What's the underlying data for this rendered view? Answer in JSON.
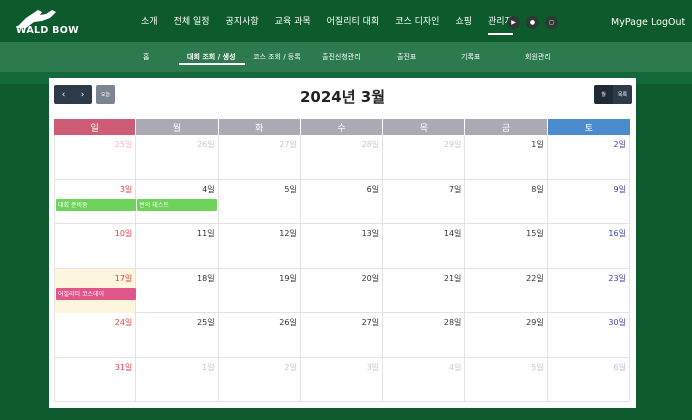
{
  "brand": {
    "name": "WALD BOW"
  },
  "nav": {
    "items": [
      {
        "label": "소개",
        "active": false
      },
      {
        "label": "전체 일정",
        "active": false
      },
      {
        "label": "공지사항",
        "active": false
      },
      {
        "label": "교육 과목",
        "active": false
      },
      {
        "label": "어질리티 대회",
        "active": false
      },
      {
        "label": "코스 디자인",
        "active": false
      },
      {
        "label": "쇼핑",
        "active": false
      },
      {
        "label": "관리자",
        "active": true
      }
    ],
    "social": [
      "youtube-icon",
      "kakao-icon",
      "instagram-icon"
    ],
    "util": {
      "mypage": "MyPage",
      "logout": "LogOut"
    }
  },
  "subnav": {
    "items": [
      {
        "label": "홈"
      },
      {
        "label": "대회 조회 / 생성"
      },
      {
        "label": "코스 조회 / 등록"
      },
      {
        "label": "출진신청관리"
      },
      {
        "label": "출진표"
      },
      {
        "label": "기록표"
      },
      {
        "label": "회원관리"
      }
    ],
    "active": "대회 조회 / 생성"
  },
  "calendar": {
    "title": "2024년 3월",
    "prev": "‹",
    "next": "›",
    "today": "오늘",
    "view_month": "월",
    "view_list": "목록",
    "weekdays": [
      "일",
      "월",
      "화",
      "수",
      "목",
      "금",
      "토"
    ],
    "weekday_colors": [
      "#cd5c74",
      "#a9aab4",
      "#a9aab4",
      "#a9aab4",
      "#a9aab4",
      "#a9aab4",
      "#4a8ccd"
    ],
    "today_label": "17일",
    "weeks": [
      [
        "25일",
        "26일",
        "27일",
        "28일",
        "29일",
        "1일",
        "2일"
      ],
      [
        "3일",
        "4일",
        "5일",
        "6일",
        "7일",
        "8일",
        "9일"
      ],
      [
        "10일",
        "11일",
        "12일",
        "13일",
        "14일",
        "15일",
        "16일"
      ],
      [
        "17일",
        "18일",
        "19일",
        "20일",
        "21일",
        "22일",
        "23일"
      ],
      [
        "24일",
        "25일",
        "26일",
        "27일",
        "28일",
        "29일",
        "30일"
      ],
      [
        "31일",
        "1일",
        "2일",
        "3일",
        "4일",
        "5일",
        "6일"
      ]
    ],
    "events": [
      {
        "title": "대회 준비중",
        "week": 1,
        "day": 0,
        "color": "#6ed35a"
      },
      {
        "title": "번의 테스트",
        "week": 1,
        "day": 1,
        "color": "#6ed35a"
      },
      {
        "title": "어질리티 코스데이",
        "week": 3,
        "day": 0,
        "color": "#e0558a"
      }
    ]
  },
  "colors": {
    "topbar": "#0d5a2c",
    "subnav": "#2d7a4e",
    "sunday": "#e0424a",
    "saturday": "#3b3fb8"
  }
}
